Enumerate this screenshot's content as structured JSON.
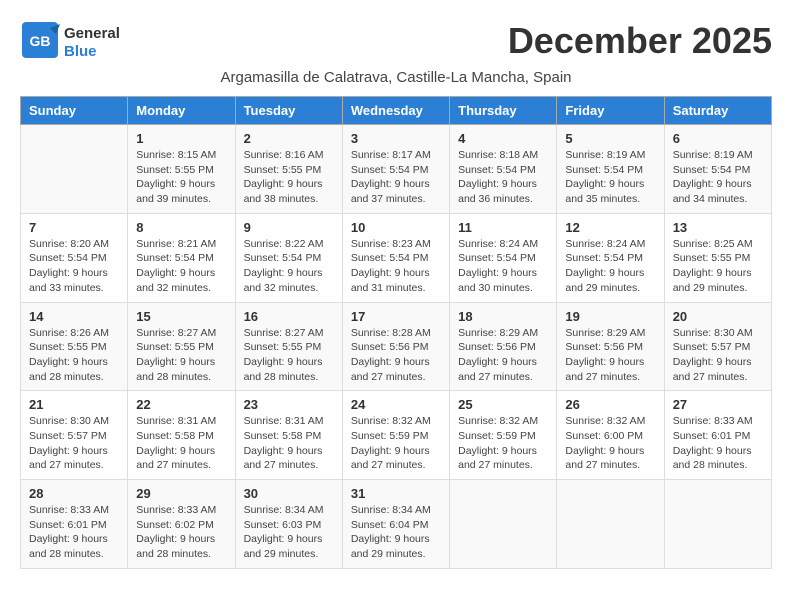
{
  "logo": {
    "text_general": "General",
    "text_blue": "Blue"
  },
  "title": "December 2025",
  "subtitle": "Argamasilla de Calatrava, Castille-La Mancha, Spain",
  "days_of_week": [
    "Sunday",
    "Monday",
    "Tuesday",
    "Wednesday",
    "Thursday",
    "Friday",
    "Saturday"
  ],
  "weeks": [
    [
      {
        "day": "",
        "sunrise": "",
        "sunset": "",
        "daylight": ""
      },
      {
        "day": "1",
        "sunrise": "Sunrise: 8:15 AM",
        "sunset": "Sunset: 5:55 PM",
        "daylight": "Daylight: 9 hours and 39 minutes."
      },
      {
        "day": "2",
        "sunrise": "Sunrise: 8:16 AM",
        "sunset": "Sunset: 5:55 PM",
        "daylight": "Daylight: 9 hours and 38 minutes."
      },
      {
        "day": "3",
        "sunrise": "Sunrise: 8:17 AM",
        "sunset": "Sunset: 5:54 PM",
        "daylight": "Daylight: 9 hours and 37 minutes."
      },
      {
        "day": "4",
        "sunrise": "Sunrise: 8:18 AM",
        "sunset": "Sunset: 5:54 PM",
        "daylight": "Daylight: 9 hours and 36 minutes."
      },
      {
        "day": "5",
        "sunrise": "Sunrise: 8:19 AM",
        "sunset": "Sunset: 5:54 PM",
        "daylight": "Daylight: 9 hours and 35 minutes."
      },
      {
        "day": "6",
        "sunrise": "Sunrise: 8:19 AM",
        "sunset": "Sunset: 5:54 PM",
        "daylight": "Daylight: 9 hours and 34 minutes."
      }
    ],
    [
      {
        "day": "7",
        "sunrise": "Sunrise: 8:20 AM",
        "sunset": "Sunset: 5:54 PM",
        "daylight": "Daylight: 9 hours and 33 minutes."
      },
      {
        "day": "8",
        "sunrise": "Sunrise: 8:21 AM",
        "sunset": "Sunset: 5:54 PM",
        "daylight": "Daylight: 9 hours and 32 minutes."
      },
      {
        "day": "9",
        "sunrise": "Sunrise: 8:22 AM",
        "sunset": "Sunset: 5:54 PM",
        "daylight": "Daylight: 9 hours and 32 minutes."
      },
      {
        "day": "10",
        "sunrise": "Sunrise: 8:23 AM",
        "sunset": "Sunset: 5:54 PM",
        "daylight": "Daylight: 9 hours and 31 minutes."
      },
      {
        "day": "11",
        "sunrise": "Sunrise: 8:24 AM",
        "sunset": "Sunset: 5:54 PM",
        "daylight": "Daylight: 9 hours and 30 minutes."
      },
      {
        "day": "12",
        "sunrise": "Sunrise: 8:24 AM",
        "sunset": "Sunset: 5:54 PM",
        "daylight": "Daylight: 9 hours and 29 minutes."
      },
      {
        "day": "13",
        "sunrise": "Sunrise: 8:25 AM",
        "sunset": "Sunset: 5:55 PM",
        "daylight": "Daylight: 9 hours and 29 minutes."
      }
    ],
    [
      {
        "day": "14",
        "sunrise": "Sunrise: 8:26 AM",
        "sunset": "Sunset: 5:55 PM",
        "daylight": "Daylight: 9 hours and 28 minutes."
      },
      {
        "day": "15",
        "sunrise": "Sunrise: 8:27 AM",
        "sunset": "Sunset: 5:55 PM",
        "daylight": "Daylight: 9 hours and 28 minutes."
      },
      {
        "day": "16",
        "sunrise": "Sunrise: 8:27 AM",
        "sunset": "Sunset: 5:55 PM",
        "daylight": "Daylight: 9 hours and 28 minutes."
      },
      {
        "day": "17",
        "sunrise": "Sunrise: 8:28 AM",
        "sunset": "Sunset: 5:56 PM",
        "daylight": "Daylight: 9 hours and 27 minutes."
      },
      {
        "day": "18",
        "sunrise": "Sunrise: 8:29 AM",
        "sunset": "Sunset: 5:56 PM",
        "daylight": "Daylight: 9 hours and 27 minutes."
      },
      {
        "day": "19",
        "sunrise": "Sunrise: 8:29 AM",
        "sunset": "Sunset: 5:56 PM",
        "daylight": "Daylight: 9 hours and 27 minutes."
      },
      {
        "day": "20",
        "sunrise": "Sunrise: 8:30 AM",
        "sunset": "Sunset: 5:57 PM",
        "daylight": "Daylight: 9 hours and 27 minutes."
      }
    ],
    [
      {
        "day": "21",
        "sunrise": "Sunrise: 8:30 AM",
        "sunset": "Sunset: 5:57 PM",
        "daylight": "Daylight: 9 hours and 27 minutes."
      },
      {
        "day": "22",
        "sunrise": "Sunrise: 8:31 AM",
        "sunset": "Sunset: 5:58 PM",
        "daylight": "Daylight: 9 hours and 27 minutes."
      },
      {
        "day": "23",
        "sunrise": "Sunrise: 8:31 AM",
        "sunset": "Sunset: 5:58 PM",
        "daylight": "Daylight: 9 hours and 27 minutes."
      },
      {
        "day": "24",
        "sunrise": "Sunrise: 8:32 AM",
        "sunset": "Sunset: 5:59 PM",
        "daylight": "Daylight: 9 hours and 27 minutes."
      },
      {
        "day": "25",
        "sunrise": "Sunrise: 8:32 AM",
        "sunset": "Sunset: 5:59 PM",
        "daylight": "Daylight: 9 hours and 27 minutes."
      },
      {
        "day": "26",
        "sunrise": "Sunrise: 8:32 AM",
        "sunset": "Sunset: 6:00 PM",
        "daylight": "Daylight: 9 hours and 27 minutes."
      },
      {
        "day": "27",
        "sunrise": "Sunrise: 8:33 AM",
        "sunset": "Sunset: 6:01 PM",
        "daylight": "Daylight: 9 hours and 28 minutes."
      }
    ],
    [
      {
        "day": "28",
        "sunrise": "Sunrise: 8:33 AM",
        "sunset": "Sunset: 6:01 PM",
        "daylight": "Daylight: 9 hours and 28 minutes."
      },
      {
        "day": "29",
        "sunrise": "Sunrise: 8:33 AM",
        "sunset": "Sunset: 6:02 PM",
        "daylight": "Daylight: 9 hours and 28 minutes."
      },
      {
        "day": "30",
        "sunrise": "Sunrise: 8:34 AM",
        "sunset": "Sunset: 6:03 PM",
        "daylight": "Daylight: 9 hours and 29 minutes."
      },
      {
        "day": "31",
        "sunrise": "Sunrise: 8:34 AM",
        "sunset": "Sunset: 6:04 PM",
        "daylight": "Daylight: 9 hours and 29 minutes."
      },
      {
        "day": "",
        "sunrise": "",
        "sunset": "",
        "daylight": ""
      },
      {
        "day": "",
        "sunrise": "",
        "sunset": "",
        "daylight": ""
      },
      {
        "day": "",
        "sunrise": "",
        "sunset": "",
        "daylight": ""
      }
    ]
  ]
}
